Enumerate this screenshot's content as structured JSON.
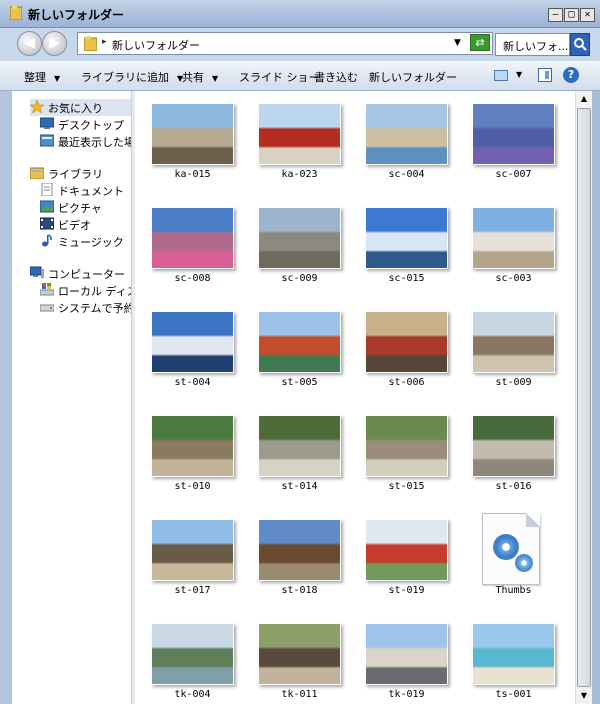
{
  "window": {
    "title": "新しいフォルダー",
    "min_label": "–",
    "max_label": "□",
    "close_label": "✕"
  },
  "address_bar": {
    "path": "新しいフォルダー",
    "separator": "▸",
    "dropdown": "▼",
    "search_value": "新しいフォ..."
  },
  "toolbar": {
    "items": [
      "整理",
      "ライブラリに追加",
      "共有",
      "スライド ショー",
      "書き込む",
      "新しいフォルダー"
    ],
    "arrow": "▼"
  },
  "nav": {
    "favorites": "お気に入り",
    "desktop": "デスクトップ",
    "recent": "最近表示した場所",
    "libraries": "ライブラリ",
    "documents": "ドキュメント",
    "pictures": "ピクチャ",
    "videos": "ビデオ",
    "music": "ミュージック",
    "computer": "コンピューター",
    "local_disk": "ローカル ディスク",
    "reserved": "システムで予約済み"
  },
  "files": [
    {
      "name": "ka-015",
      "colors": [
        "#8fb8e0",
        "#b6a990",
        "#6e5f4c"
      ]
    },
    {
      "name": "ka-023",
      "colors": [
        "#bcd6ef",
        "#b72c22",
        "#d9d2c2"
      ]
    },
    {
      "name": "sc-004",
      "colors": [
        "#a6c6e4",
        "#cbbfa4",
        "#5d8fbf"
      ]
    },
    {
      "name": "sc-007",
      "colors": [
        "#5f7fbf",
        "#4e5fa8",
        "#7260b0"
      ]
    },
    {
      "name": "sc-008",
      "colors": [
        "#4a7fc8",
        "#b06a8e",
        "#d85e96"
      ]
    },
    {
      "name": "sc-009",
      "colors": [
        "#9eb4cc",
        "#8c8a80",
        "#6f6a5c"
      ]
    },
    {
      "name": "sc-015",
      "colors": [
        "#3f78d0",
        "#d8e6f4",
        "#2d5a8a"
      ]
    },
    {
      "name": "sc-003",
      "colors": [
        "#7fb0e2",
        "#e6e0d6",
        "#b3a58c"
      ]
    },
    {
      "name": "st-004",
      "colors": [
        "#3c74c4",
        "#dfe6ee",
        "#1f3f70"
      ]
    },
    {
      "name": "st-005",
      "colors": [
        "#9cc2ea",
        "#c24c2c",
        "#3f7a50"
      ]
    },
    {
      "name": "st-006",
      "colors": [
        "#c8b08a",
        "#a83a2c",
        "#5a4436"
      ]
    },
    {
      "name": "st-009",
      "colors": [
        "#c8d6e4",
        "#8a7662",
        "#d0c4b0"
      ]
    },
    {
      "name": "st-010",
      "colors": [
        "#4c7a3e",
        "#8a7a5e",
        "#c2b49a"
      ]
    },
    {
      "name": "st-014",
      "colors": [
        "#4f6b3a",
        "#9c9a8e",
        "#d7d2c4"
      ]
    },
    {
      "name": "st-015",
      "colors": [
        "#6a8a50",
        "#9a8e7a",
        "#d4cebe"
      ]
    },
    {
      "name": "st-016",
      "colors": [
        "#4a6a3e",
        "#c2bcae",
        "#8e877a"
      ]
    },
    {
      "name": "st-017",
      "colors": [
        "#8fbde6",
        "#6a5a48",
        "#c8b89a"
      ]
    },
    {
      "name": "st-018",
      "colors": [
        "#5f8cc8",
        "#6a4a30",
        "#9a8a70"
      ]
    },
    {
      "name": "st-019",
      "colors": [
        "#dfe8ef",
        "#c83a2c",
        "#6f9a5a"
      ]
    },
    {
      "name": "Thumbs",
      "icon": "gear-file-icon"
    },
    {
      "name": "tk-004",
      "colors": [
        "#c8d8e4",
        "#5f7f5a",
        "#7fa0a8"
      ]
    },
    {
      "name": "tk-011",
      "colors": [
        "#8ea06a",
        "#5a4a3e",
        "#c2b49a"
      ]
    },
    {
      "name": "tk-019",
      "colors": [
        "#9ec4ee",
        "#dcd4c8",
        "#6a6a70"
      ]
    },
    {
      "name": "ts-001",
      "colors": [
        "#9bc6ee",
        "#58b8d0",
        "#e8e0d0"
      ]
    }
  ],
  "scrollbar": {
    "up": "▲",
    "down": "▼"
  },
  "help_label": "?"
}
